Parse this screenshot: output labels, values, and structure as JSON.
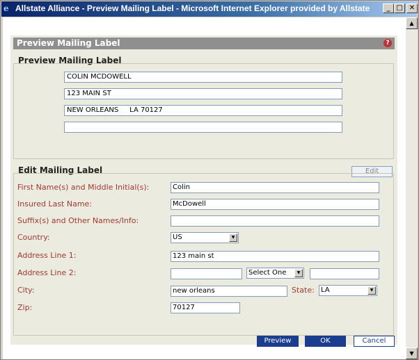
{
  "window": {
    "title": "Allstate Alliance - Preview Mailing Label - Microsoft Internet Explorer provided by Allstate",
    "minimize_glyph": "_",
    "maximize_glyph": "□",
    "close_glyph": "✕",
    "app_icon": "ie-icon"
  },
  "panel": {
    "header": "Preview Mailing Label",
    "help_glyph": "?"
  },
  "preview": {
    "title": "Preview Mailing Label",
    "lines": [
      "COLIN MCDOWELL",
      "123 MAIN ST",
      "NEW ORLEANS     LA 70127",
      ""
    ],
    "edit_label": "Edit"
  },
  "edit": {
    "title": "Edit Mailing Label",
    "first_name_label": "First Name(s) and Middle Initial(s):",
    "first_name_value": "Colin",
    "last_name_label": "Insured Last Name:",
    "last_name_value": "McDowell",
    "suffix_label": "Suffix(s) and Other Names/Info:",
    "suffix_value": "",
    "country_label": "Country:",
    "country_value": "US",
    "address1_label": "Address Line 1:",
    "address1_value": "123 main st",
    "address2_label": "Address Line 2:",
    "address2_value": "",
    "address2_select": "Select One",
    "address2_extra": "",
    "city_label": "City:",
    "city_value": "new orleans",
    "state_label": "State:",
    "state_value": "LA",
    "zip_label": "Zip:",
    "zip_value": "70127"
  },
  "buttons": {
    "preview": "Preview",
    "ok": "OK",
    "cancel": "Cancel"
  },
  "colors": {
    "label_red": "#a03a32",
    "button_blue": "#1a3d8f",
    "panel_bg": "#ecebdf"
  }
}
